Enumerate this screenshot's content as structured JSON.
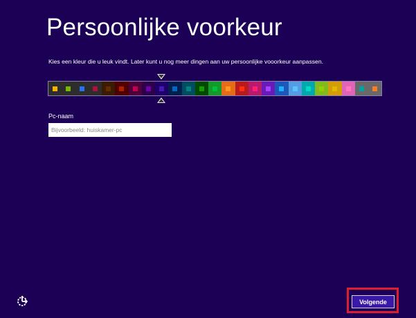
{
  "title": "Persoonlijke voorkeur",
  "description": "Kies een kleur die u leuk vindt. Later kunt u nog meer dingen aan uw persoonlijke vooorkeur aanpassen.",
  "color_picker": {
    "selected_index": 8,
    "swatches": [
      {
        "bg": "#2d2d2d",
        "fg": "#f4b300"
      },
      {
        "bg": "#2d2d2d",
        "fg": "#78ba00"
      },
      {
        "bg": "#2d2d2d",
        "fg": "#2673ec"
      },
      {
        "bg": "#2d2d2d",
        "fg": "#ae113d"
      },
      {
        "bg": "#3b1c00",
        "fg": "#632f00"
      },
      {
        "bg": "#4e0000",
        "fg": "#b01e00"
      },
      {
        "bg": "#4e0038",
        "fg": "#c1004f"
      },
      {
        "bg": "#2d004e",
        "fg": "#7200ac"
      },
      {
        "bg": "#1f0068",
        "fg": "#4617b4"
      },
      {
        "bg": "#001e4e",
        "fg": "#006ac1"
      },
      {
        "bg": "#004d60",
        "fg": "#008287"
      },
      {
        "bg": "#004a00",
        "fg": "#199900"
      },
      {
        "bg": "#15992a",
        "fg": "#00c13f"
      },
      {
        "bg": "#e56c19",
        "fg": "#ff981d"
      },
      {
        "bg": "#b81b1b",
        "fg": "#ff2e12"
      },
      {
        "bg": "#b81b6c",
        "fg": "#ff1d77"
      },
      {
        "bg": "#691bb8",
        "fg": "#aa40ff"
      },
      {
        "bg": "#1b58b8",
        "fg": "#1faeff"
      },
      {
        "bg": "#569ce3",
        "fg": "#56c5ff"
      },
      {
        "bg": "#00aaaa",
        "fg": "#00d8cc"
      },
      {
        "bg": "#83ba1f",
        "fg": "#91d100"
      },
      {
        "bg": "#d39d09",
        "fg": "#e1b700"
      },
      {
        "bg": "#e064b7",
        "fg": "#ff76bc"
      },
      {
        "bg": "#696969",
        "fg": "#00a3a3"
      },
      {
        "bg": "#696969",
        "fg": "#fe7c22"
      }
    ]
  },
  "pc_name": {
    "label": "Pc-naam",
    "value": "",
    "placeholder": "Bijvoorbeeld: huiskamer-pc"
  },
  "footer": {
    "ease_of_access_icon": "ease-of-access-icon",
    "next_label": "Volgende"
  }
}
